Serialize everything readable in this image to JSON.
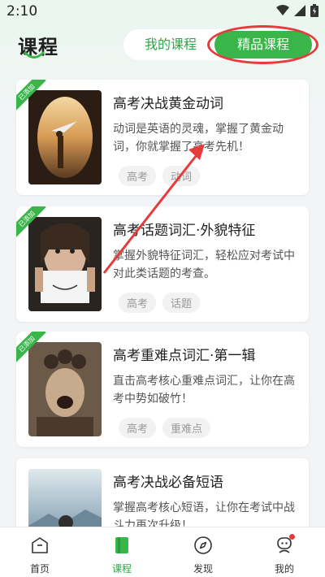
{
  "status_bar": {
    "time": "2:10"
  },
  "header": {
    "title": "课程",
    "tabs": [
      {
        "label": "我的课程",
        "active": false
      },
      {
        "label": "精品课程",
        "active": true
      }
    ]
  },
  "courses": [
    {
      "title": "高考决战黄金动词",
      "desc": "动词是英语的灵魂，掌握了黄金动词，你就掌握了高考先机！",
      "tags": [
        "高考",
        "动词"
      ],
      "badge": "已添加"
    },
    {
      "title": "高考话题词汇·外貌特征",
      "desc": "掌握外貌特征词汇，轻松应对考试中对此类话题的考查。",
      "tags": [
        "高考",
        "话题"
      ],
      "badge": "已添加"
    },
    {
      "title": "高考重难点词汇·第一辑",
      "desc": "直击高考核心重难点词汇，让你在高考中势如破竹！",
      "tags": [
        "高考",
        "重难点"
      ],
      "badge": "已添加"
    },
    {
      "title": "高考决战必备短语",
      "desc": "掌握高考核心短语，让你在考试中战斗力再次升级！",
      "tags": [],
      "badge": ""
    }
  ],
  "bottom_nav": [
    {
      "label": "首页",
      "icon": "home-icon",
      "active": false
    },
    {
      "label": "课程",
      "icon": "book-icon",
      "active": true
    },
    {
      "label": "发现",
      "icon": "compass-icon",
      "active": false
    },
    {
      "label": "我的",
      "icon": "profile-icon",
      "active": false
    }
  ],
  "colors": {
    "accent": "#3ab54a",
    "annotation": "#e63b3b"
  }
}
